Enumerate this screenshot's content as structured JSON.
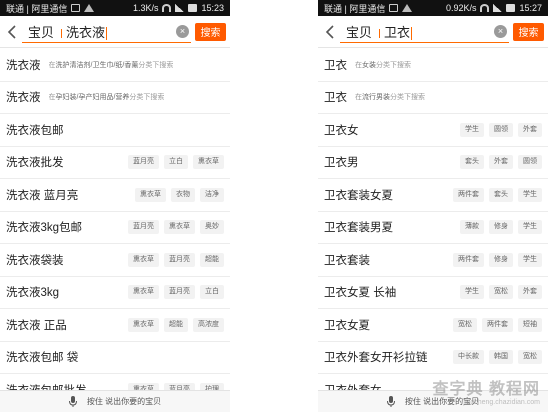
{
  "left": {
    "status": {
      "carrier": "联通 | 阿里通信",
      "speed": "1.3K/s",
      "time": "15:23"
    },
    "search": {
      "category": "宝贝",
      "query": "洗衣液",
      "button": "搜索"
    },
    "suggestions": [
      {
        "term": "洗衣液",
        "hint_prefix": "在",
        "hint_cat": "洗护清洁剂/卫生巾/纸/香薰",
        "hint_suffix": "分类下搜索",
        "tags": []
      },
      {
        "term": "洗衣液",
        "hint_prefix": "在",
        "hint_cat": "孕妇装/孕产妇用品/营养",
        "hint_suffix": "分类下搜索",
        "tags": []
      },
      {
        "term": "洗衣液包邮",
        "tags": []
      },
      {
        "term": "洗衣液批发",
        "tags": [
          "蓝月亮",
          "立白",
          "熏衣草"
        ]
      },
      {
        "term": "洗衣液 蓝月亮",
        "tags": [
          "熏衣草",
          "衣物",
          "洁净"
        ]
      },
      {
        "term": "洗衣液3kg包邮",
        "tags": [
          "蓝月亮",
          "熏衣草",
          "奥妙"
        ]
      },
      {
        "term": "洗衣液袋装",
        "tags": [
          "熏衣草",
          "蓝月亮",
          "超能"
        ]
      },
      {
        "term": "洗衣液3kg",
        "tags": [
          "熏衣草",
          "蓝月亮",
          "立白"
        ]
      },
      {
        "term": "洗衣液 正品",
        "tags": [
          "熏衣草",
          "超能",
          "高浓度"
        ]
      },
      {
        "term": "洗衣液包邮 袋",
        "tags": []
      },
      {
        "term": "洗衣液包邮批发",
        "tags": [
          "熏衣草",
          "蓝月亮",
          "护理"
        ]
      }
    ],
    "voice": "按住 说出你要的宝贝"
  },
  "right": {
    "status": {
      "carrier": "联通 | 阿里通信",
      "speed": "0.92K/s",
      "time": "15:27"
    },
    "search": {
      "category": "宝贝",
      "query": "卫衣",
      "button": "搜索"
    },
    "suggestions": [
      {
        "term": "卫衣",
        "hint_prefix": "在",
        "hint_cat": "女装",
        "hint_suffix": "分类下搜索",
        "tags": []
      },
      {
        "term": "卫衣",
        "hint_prefix": "在",
        "hint_cat": "流行男装",
        "hint_suffix": "分类下搜索",
        "tags": []
      },
      {
        "term": "卫衣女",
        "tags": [
          "学生",
          "圆领",
          "外套"
        ]
      },
      {
        "term": "卫衣男",
        "tags": [
          "套头",
          "外套",
          "圆领"
        ]
      },
      {
        "term": "卫衣套装女夏",
        "tags": [
          "两件套",
          "套头",
          "学生"
        ]
      },
      {
        "term": "卫衣套装男夏",
        "tags": [
          "薄款",
          "修身",
          "学生"
        ]
      },
      {
        "term": "卫衣套装",
        "tags": [
          "两件套",
          "修身",
          "学生"
        ]
      },
      {
        "term": "卫衣女夏 长袖",
        "tags": [
          "学生",
          "宽松",
          "外套"
        ]
      },
      {
        "term": "卫衣女夏",
        "tags": [
          "宽松",
          "两件套",
          "短袖"
        ]
      },
      {
        "term": "卫衣外套女开衫拉链",
        "tags": [
          "中长款",
          "韩国",
          "宽松"
        ]
      },
      {
        "term": "卫衣外套女",
        "tags": []
      }
    ],
    "voice": "按住 说出你要的宝贝"
  },
  "watermark": {
    "main": "查字典 教程网",
    "sub": "jiaocheng.chazidian.com"
  },
  "colors": {
    "accent": "#ff5a00",
    "statusbar": "#111111",
    "tag_bg": "#f2f2f2"
  }
}
